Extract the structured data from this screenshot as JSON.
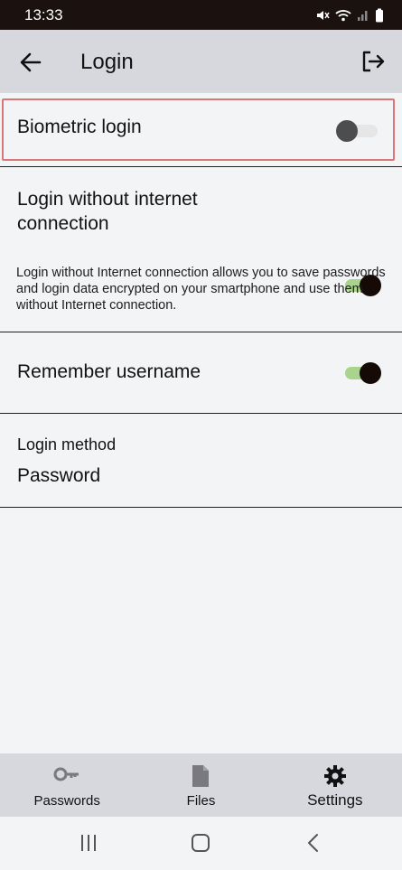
{
  "status_bar": {
    "time": "13:33",
    "icons": [
      "mute-icon",
      "wifi-icon",
      "signal-icon",
      "battery-icon"
    ]
  },
  "app_bar": {
    "title": "Login",
    "back_icon": "arrow-left-icon",
    "logout_icon": "logout-icon"
  },
  "settings": {
    "biometric": {
      "label": "Biometric login",
      "enabled": false
    },
    "offline": {
      "label": "Login without internet connection",
      "enabled": true,
      "description": "Login without Internet connection allows you to save passwords and login data encrypted on your smartphone and use them without Internet connection."
    },
    "remember": {
      "label": "Remember username",
      "enabled": true
    },
    "method": {
      "label": "Login method",
      "value": "Password"
    }
  },
  "bottom_nav": {
    "items": [
      {
        "label": "Passwords",
        "icon": "key-icon",
        "active": false
      },
      {
        "label": "Files",
        "icon": "file-icon",
        "active": false
      },
      {
        "label": "Settings",
        "icon": "gear-icon",
        "active": true
      }
    ]
  },
  "colors": {
    "toggle_on_track": "#a8d48b",
    "toggle_on_thumb": "#150a06",
    "highlight_border": "#d97777",
    "bar_background": "#d7d8dd"
  }
}
